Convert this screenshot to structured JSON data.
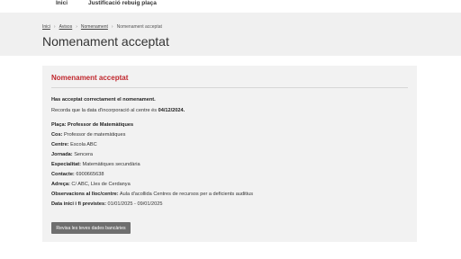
{
  "topnav": {
    "home": "Inici",
    "current": "Justificació rebuig plaça"
  },
  "breadcrumb": {
    "items": [
      "Inici",
      "Avisos",
      "Nomenament",
      "Nomenament acceptat"
    ]
  },
  "page": {
    "title": "Nomenament acceptat"
  },
  "card": {
    "title": "Nomenament acceptat",
    "confirmation": "Has acceptat correctament el nomenament.",
    "reminder_prefix": "Recorda que la data d'incorporació al centre és ",
    "reminder_date": "04/12/2024.",
    "fields": [
      {
        "label": "Plaça:",
        "value": "Professor de Matemàtiques",
        "bold_value": true
      },
      {
        "label": "Cos:",
        "value": "Professor de matemàtiques",
        "bold_value": false
      },
      {
        "label": "Centre:",
        "value": "Escola ABC",
        "bold_value": false
      },
      {
        "label": "Jornada:",
        "value": "Sencera",
        "bold_value": false
      },
      {
        "label": "Especialitat:",
        "value": "Matemàtiques secundària",
        "bold_value": false
      },
      {
        "label": "Contacte:",
        "value": "6900665638",
        "bold_value": false
      },
      {
        "label": "Adreça:",
        "value": "C/ ABC, Lles de Cerdanya",
        "bold_value": false
      },
      {
        "label": "Observacions al lloc/centre:",
        "value": "Aula d'acollida Centres de recursos per a deficients auditius",
        "bold_value": false
      },
      {
        "label": "Data inici i fi previstes:",
        "value": "01/01/2025 - 09/01/2025",
        "bold_value": false
      }
    ],
    "button_label": "Revisa les teves dades bancàries"
  }
}
